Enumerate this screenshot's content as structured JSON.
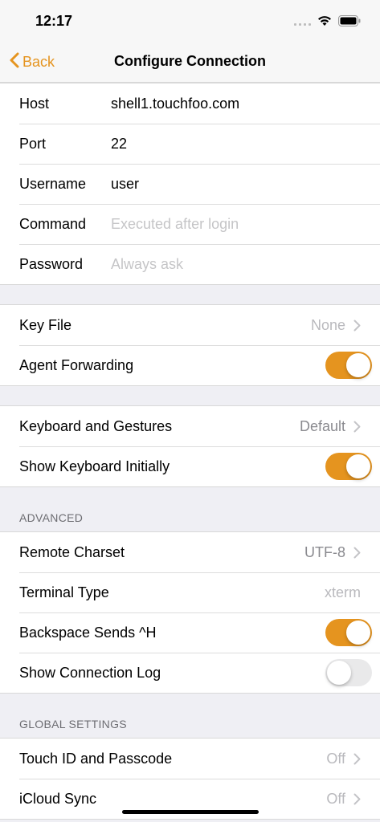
{
  "status": {
    "time": "12:17"
  },
  "nav": {
    "back_label": "Back",
    "title": "Configure Connection"
  },
  "connection": [
    {
      "label": "Host",
      "value": "shell1.touchfoo.com",
      "placeholder": ""
    },
    {
      "label": "Port",
      "value": "22",
      "placeholder": ""
    },
    {
      "label": "Username",
      "value": "user",
      "placeholder": ""
    },
    {
      "label": "Command",
      "value": "",
      "placeholder": "Executed after login"
    },
    {
      "label": "Password",
      "value": "",
      "placeholder": "Always ask"
    }
  ],
  "auth": {
    "key_file_label": "Key File",
    "key_file_value": "None",
    "agent_forwarding_label": "Agent Forwarding",
    "agent_forwarding_on": true
  },
  "keyboard": {
    "gestures_label": "Keyboard and Gestures",
    "gestures_value": "Default",
    "show_keyboard_label": "Show Keyboard Initially",
    "show_keyboard_on": true
  },
  "advanced": {
    "header": "ADVANCED",
    "charset_label": "Remote Charset",
    "charset_value": "UTF-8",
    "terminal_type_label": "Terminal Type",
    "terminal_type_placeholder": "xterm",
    "backspace_label": "Backspace Sends ^H",
    "backspace_on": true,
    "connection_log_label": "Show Connection Log",
    "connection_log_on": false
  },
  "global": {
    "header": "GLOBAL SETTINGS",
    "touch_id_label": "Touch ID and Passcode",
    "touch_id_value": "Off",
    "icloud_label": "iCloud Sync",
    "icloud_value": "Off"
  },
  "colors": {
    "accent": "#e5941f",
    "background": "#efeff4",
    "placeholder": "#c5c5c7"
  }
}
